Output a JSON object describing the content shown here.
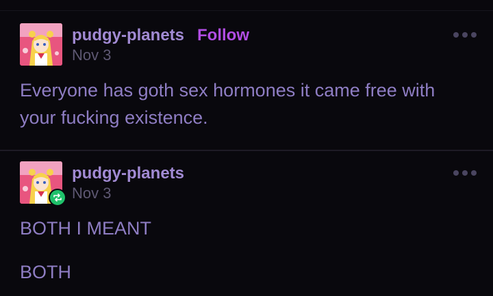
{
  "theme": {
    "background": "#09080d",
    "username_color": "#a18ad3",
    "follow_color": "#b14de3",
    "date_color": "#5e5873",
    "body_color": "#8e7dc3",
    "reblog_badge_color": "#1fc16a"
  },
  "post": {
    "username": "pudgy-planets",
    "follow_label": "Follow",
    "date": "Nov 3",
    "text": "Everyone has goth sex hormones it came free with your fucking existence.",
    "menu_icon": "more-dots-icon"
  },
  "reblog": {
    "username": "pudgy-planets",
    "date": "Nov 3",
    "badge_icon": "reblog-icon",
    "paragraphs": [
      "BOTH I MEANT",
      "BOTH"
    ],
    "menu_icon": "more-dots-icon"
  }
}
